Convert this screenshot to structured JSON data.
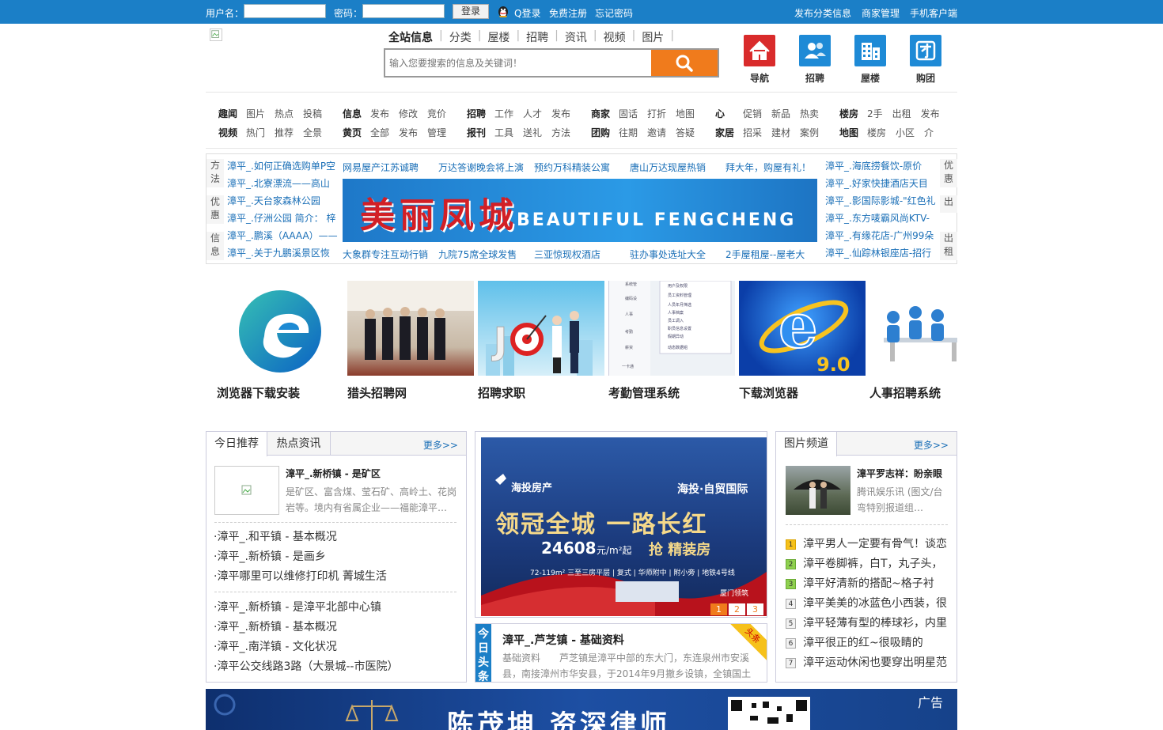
{
  "topbar": {
    "username_label": "用户名：",
    "password_label": "密码：",
    "login_button": "登录",
    "qq_login": "Q登录",
    "register": "免费注册",
    "forgot": "忘记密码",
    "right_links": [
      "发布分类信息",
      "商家管理",
      "手机客户端"
    ]
  },
  "search": {
    "tabs": [
      "全站信息",
      "分类",
      "屋楼",
      "招聘",
      "资讯",
      "视频",
      "图片"
    ],
    "placeholder": "输入您要搜索的信息及关键词！"
  },
  "quick_icons": [
    {
      "label": "导航",
      "icon": "home-icon",
      "color": "#d92b2b"
    },
    {
      "label": "招聘",
      "icon": "users-icon",
      "color": "#1e8ad6"
    },
    {
      "label": "屋楼",
      "icon": "building-icon",
      "color": "#1e8ad6"
    },
    {
      "label": "购团",
      "icon": "group-buy-icon",
      "color": "#1e8ad6"
    }
  ],
  "categories": [
    {
      "rows": [
        {
          "head": "趣闻",
          "items": [
            "图片",
            "热点",
            "投稿"
          ]
        },
        {
          "head": "视频",
          "items": [
            "热门",
            "推荐",
            "全景"
          ]
        }
      ]
    },
    {
      "rows": [
        {
          "head": "信息",
          "items": [
            "发布",
            "修改",
            "竞价"
          ]
        },
        {
          "head": "黄页",
          "items": [
            "全部",
            "发布",
            "管理"
          ]
        }
      ]
    },
    {
      "rows": [
        {
          "head": "招聘",
          "items": [
            "工作",
            "人才",
            "发布"
          ]
        },
        {
          "head": "报刊",
          "items": [
            "工具",
            "送礼",
            "方法"
          ]
        }
      ]
    },
    {
      "rows": [
        {
          "head": "商家",
          "items": [
            "固话",
            "打折",
            "地图"
          ]
        },
        {
          "head": "团购",
          "items": [
            "往期",
            "邀请",
            "答疑"
          ]
        }
      ]
    },
    {
      "rows": [
        {
          "head": "心",
          "items": [
            "促销",
            "新品",
            "热卖"
          ]
        },
        {
          "head": "家居",
          "items": [
            "招采",
            "建材",
            "案例"
          ]
        }
      ]
    },
    {
      "rows": [
        {
          "head": "楼房",
          "items": [
            "2手",
            "出租",
            "发布"
          ]
        },
        {
          "head": "地图",
          "items": [
            "楼房",
            "小区",
            "介"
          ]
        }
      ]
    }
  ],
  "notice": {
    "left_tabs": [
      "方法",
      "优惠",
      "信息"
    ],
    "right_tabs": [
      "优惠",
      "出",
      "出租"
    ],
    "left_list": [
      "漳平_.如何正确选购单P空",
      "漳平_.北寮漂流——高山",
      "漳平_.天台家森林公园",
      "漳平_.仔洲公园 简介： 梓",
      "漳平_.鹏溪（AAAA）——",
      "漳平_.关于九鹏溪景区恢"
    ],
    "top_row": [
      "网易屋产江苏诚聘",
      "万达答谢晚会将上演",
      "预约万科精装公寓",
      "唐山万达现屋热销",
      "拜大年，购屋有礼！"
    ],
    "bottom_row": [
      "大象群专注互动行销",
      "九院75席全球发售",
      "三亚惊现权酒店",
      "驻办事处选址大全",
      "2手屋租屋--屋老大"
    ],
    "banner_title": "美丽凤城",
    "banner_sub": "BEAUTIFUL FENGCHENG",
    "right_list": [
      "漳平_.海底捞餐饮-原价",
      "漳平_.好家快捷酒店天目",
      "漳平_.影国际影城-\"红色礼",
      "漳平_.东方唛霸风尚KTV-",
      "漳平_.有缘花店-广州99朵",
      "漳平_.仙踪林银座店-招行"
    ]
  },
  "gallery": [
    {
      "caption": "浏览器下载安装",
      "icon": "edge-logo-icon"
    },
    {
      "caption": "猎头招聘网",
      "icon": "group-photo-icon"
    },
    {
      "caption": "招聘求职",
      "icon": "job-dart-icon"
    },
    {
      "caption": "考勤管理系统",
      "icon": "software-menu-icon"
    },
    {
      "caption": "下载浏览器",
      "icon": "ie-logo-icon"
    },
    {
      "caption": "人事招聘系统",
      "icon": "people-desk-icon"
    }
  ],
  "left_panel": {
    "tabs": [
      "今日推荐",
      "热点资讯"
    ],
    "more": "更多>>",
    "feature_title": "漳平_.新桥镇 - 是矿区",
    "feature_desc": "是矿区、富含煤、莹石矿、高岭土、花岗岩等。境内有省属企业——福能漳平…",
    "list_a": [
      "·漳平_.和平镇 - 基本概况",
      "·漳平_.新桥镇 - 是画乡",
      "·漳平哪里可以维修打印机 菁城生活"
    ],
    "list_b": [
      "·漳平_.新桥镇 - 是漳平北部中心镇",
      "·漳平_.新桥镇 - 基本概况",
      "·漳平_.南洋镇 - 文化状况",
      "·漳平公交线路3路（大景城--市医院）"
    ]
  },
  "center": {
    "slide_brand": "海投房产",
    "slide_brand2": "海投·自贸国际",
    "slide_headline": "领冠全城 一路长红",
    "slide_price": "24608",
    "slide_unit": "元/m²起",
    "slide_tag": "抢 精装房",
    "slide_note": "72-119m² 三至三房平层 | 复式 | 华师附中 | 附小旁 | 地铁4号线",
    "slide_corner": "厦门领筑",
    "pages": [
      "1",
      "2",
      "3"
    ],
    "headline_tag": "今日头条",
    "headline_corner": "头条",
    "headline_title": "漳平_.芦芝镇 - 基础资料",
    "headline_desc": "基础资料　　芦芝镇是漳平中部的东大门，东连泉州市安溪县，南接漳州市华安县，于2014年9月撤乡设镇，全镇国土"
  },
  "right_panel": {
    "tab": "图片频道",
    "more": "更多>>",
    "feature_title": "漳平罗志祥：盼亲眼",
    "feature_desc": "腾讯娱乐讯 (图文/台弯特别报道组…",
    "list": [
      "漳平男人一定要有骨气！谈恋",
      "漳平卷脚裤，白T，丸子头，",
      "漳平好清新的搭配~格子衬",
      "漳平美美的冰蓝色小西装，很",
      "漳平轻薄有型的棒球衫，内里",
      "漳平很正的红~很吸睛的",
      "漳平运动休闲也要穿出明星范"
    ],
    "ranks": [
      "1",
      "2",
      "3",
      "4",
      "5",
      "6",
      "7"
    ]
  },
  "ad": {
    "label": "广告",
    "text": "陈茂坤 资深律师"
  }
}
